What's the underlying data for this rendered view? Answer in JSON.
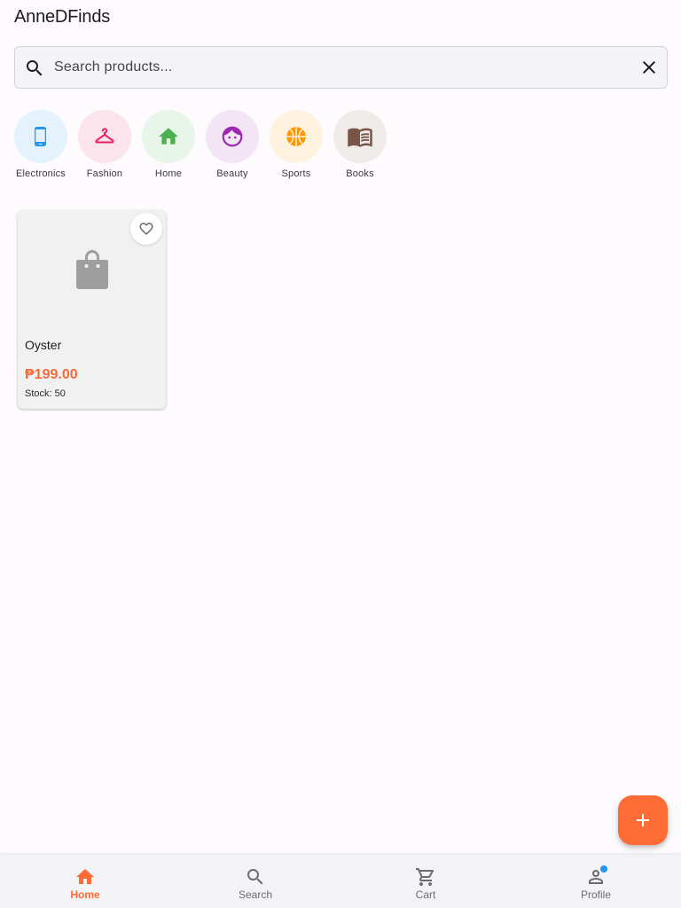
{
  "app": {
    "title": "AnneDFinds"
  },
  "search": {
    "placeholder": "Search products...",
    "value": ""
  },
  "categories": [
    {
      "label": "Electronics",
      "icon": "smartphone-icon",
      "bg": "#e3f2fd",
      "color": "#2196f3"
    },
    {
      "label": "Fashion",
      "icon": "hanger-icon",
      "bg": "#fce4ec",
      "color": "#e91e63"
    },
    {
      "label": "Home",
      "icon": "home-icon",
      "bg": "#e8f5e9",
      "color": "#4caf50"
    },
    {
      "label": "Beauty",
      "icon": "face-icon",
      "bg": "#f3e5f5",
      "color": "#9c27b0"
    },
    {
      "label": "Sports",
      "icon": "basketball-icon",
      "bg": "#fff3e0",
      "color": "#ff9800"
    },
    {
      "label": "Books",
      "icon": "book-icon",
      "bg": "#efebe9",
      "color": "#795548"
    }
  ],
  "products": [
    {
      "name": "Oyster",
      "price": "₱199.00",
      "stock": "Stock: 50"
    }
  ],
  "nav": {
    "items": [
      {
        "label": "Home",
        "icon": "home-icon",
        "active": true
      },
      {
        "label": "Search",
        "icon": "search-icon",
        "active": false
      },
      {
        "label": "Cart",
        "icon": "cart-icon",
        "active": false
      },
      {
        "label": "Profile",
        "icon": "person-icon",
        "active": false,
        "badge": true
      }
    ]
  },
  "colors": {
    "accent": "#fe6c35",
    "price": "#f26b3a",
    "badge": "#2196f3"
  }
}
